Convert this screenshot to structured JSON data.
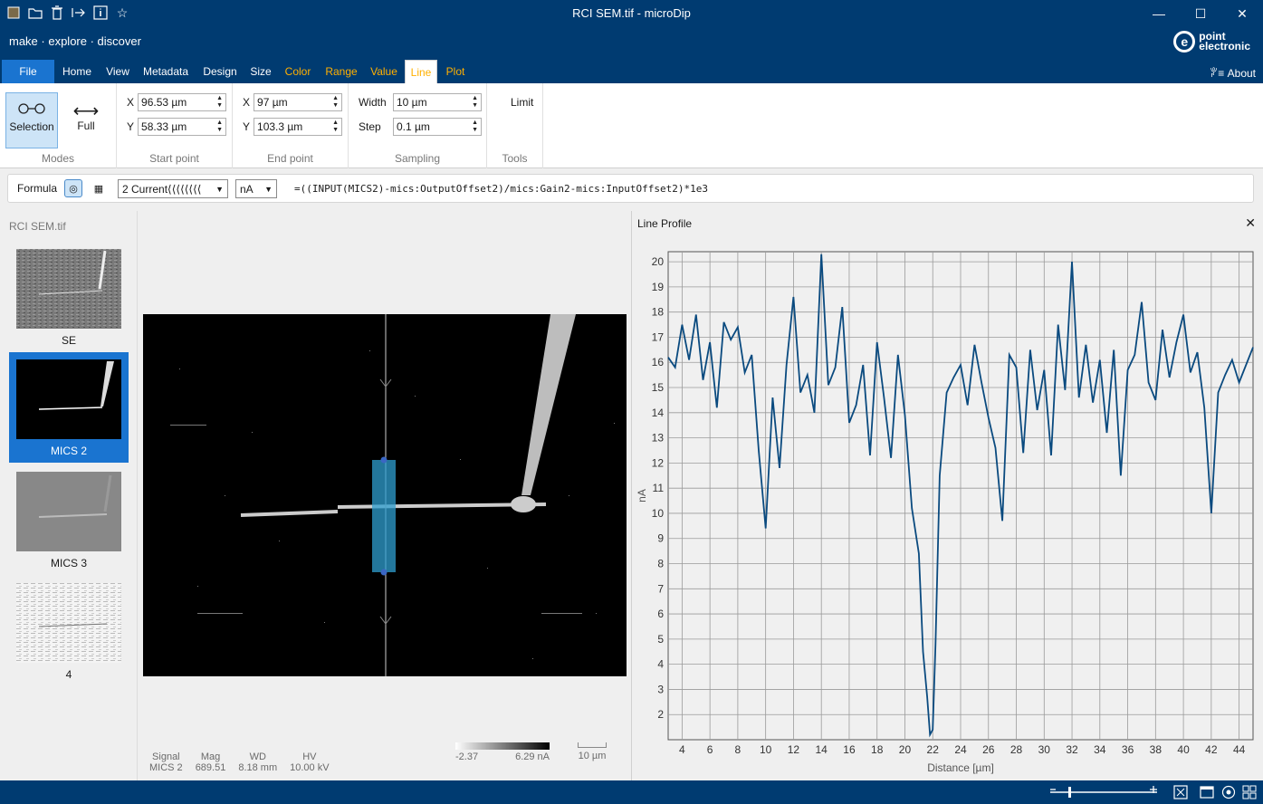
{
  "window": {
    "title": "RCI SEM.tif - microDip",
    "minimize": "—",
    "maximize": "☐",
    "close": "✕"
  },
  "brand": {
    "slogan": "make · explore · discover",
    "logo_line1": "point",
    "logo_line2": "electronic",
    "logo_mark": "e"
  },
  "menu": {
    "file": "File",
    "items": [
      "Home",
      "View",
      "Metadata",
      "Design",
      "Size",
      "Color",
      "Range",
      "Value",
      "Line",
      "Plot"
    ],
    "about": "About"
  },
  "ribbon": {
    "modes": {
      "label": "Modes",
      "selection": "Selection",
      "full": "Full"
    },
    "start": {
      "label": "Start point",
      "x_label": "X",
      "x": "96.53 µm",
      "y_label": "Y",
      "y": "58.33 µm"
    },
    "end": {
      "label": "End point",
      "x_label": "X",
      "x": "97 µm",
      "y_label": "Y",
      "y": "103.3 µm"
    },
    "sampling": {
      "label": "Sampling",
      "width_label": "Width",
      "width": "10 µm",
      "step_label": "Step",
      "step": "0.1 µm"
    },
    "tools": {
      "label": "Tools",
      "limit": "Limit"
    }
  },
  "formula": {
    "label": "Formula",
    "signal": "2 Current⟨⟨⟨⟨⟨⟨⟨⟨",
    "unit": "nA",
    "expr": "=((INPUT(MICS2)-mics:OutputOffset2)/mics:Gain2-mics:InputOffset2)*1e3"
  },
  "sidebar": {
    "title": "RCI SEM.tif",
    "items": [
      {
        "label": "SE"
      },
      {
        "label": "MICS 2"
      },
      {
        "label": "MICS 3"
      },
      {
        "label": "4"
      }
    ]
  },
  "viewer": {
    "info": {
      "signal_label": "Signal",
      "signal": "MICS 2",
      "mag_label": "Mag",
      "mag": "689.51",
      "wd_label": "WD",
      "wd": "8.18 mm",
      "hv_label": "HV",
      "hv": "10.00 kV"
    },
    "colorbar": {
      "min": "-2.37",
      "max": "6.29 nA"
    },
    "scalebar": "10 µm"
  },
  "plot": {
    "pane_title": "Line Profile",
    "close": "✕"
  },
  "chart_data": {
    "type": "line",
    "xlabel": "Distance [µm]",
    "ylabel": "nA",
    "xlim": [
      3,
      45
    ],
    "ylim": [
      1,
      20.4
    ],
    "xticks": [
      4,
      6,
      8,
      10,
      12,
      14,
      16,
      18,
      20,
      22,
      24,
      26,
      28,
      30,
      32,
      34,
      36,
      38,
      40,
      42,
      44
    ],
    "yticks": [
      2,
      3,
      4,
      5,
      6,
      7,
      8,
      9,
      10,
      11,
      12,
      13,
      14,
      15,
      16,
      17,
      18,
      19,
      20
    ],
    "grid": true,
    "series": [
      {
        "color": "#0a4a7f",
        "x": [
          3,
          3.5,
          4,
          4.5,
          5,
          5.5,
          6,
          6.5,
          7,
          7.5,
          8,
          8.5,
          9,
          9.5,
          10,
          10.5,
          11,
          11.5,
          12,
          12.5,
          13,
          13.5,
          14,
          14.5,
          15,
          15.5,
          16,
          16.5,
          17,
          17.5,
          18,
          18.5,
          19,
          19.5,
          20,
          20.5,
          21,
          21.3,
          21.6,
          21.8,
          22,
          22.2,
          22.5,
          23,
          23.5,
          24,
          24.5,
          25,
          25.5,
          26,
          26.5,
          27,
          27.5,
          28,
          28.5,
          29,
          29.5,
          30,
          30.5,
          31,
          31.5,
          32,
          32.5,
          33,
          33.5,
          34,
          34.5,
          35,
          35.5,
          36,
          36.5,
          37,
          37.5,
          38,
          38.5,
          39,
          39.5,
          40,
          40.5,
          41,
          41.5,
          42,
          42.5,
          43,
          43.5,
          44,
          44.5,
          45
        ],
        "y": [
          16.2,
          15.8,
          17.5,
          16.1,
          17.9,
          15.3,
          16.8,
          14.2,
          17.6,
          16.9,
          17.4,
          15.6,
          16.3,
          12.5,
          9.4,
          14.6,
          11.8,
          15.9,
          18.6,
          14.8,
          15.5,
          14.0,
          20.3,
          15.1,
          15.8,
          18.2,
          13.6,
          14.3,
          15.9,
          12.3,
          16.8,
          14.6,
          12.2,
          16.3,
          13.9,
          10.2,
          8.4,
          4.5,
          2.7,
          1.2,
          1.4,
          4.8,
          11.5,
          14.8,
          15.4,
          15.9,
          14.3,
          16.7,
          15.2,
          13.8,
          12.6,
          9.7,
          16.3,
          15.8,
          12.4,
          16.5,
          14.1,
          15.7,
          12.3,
          17.5,
          14.9,
          20.0,
          14.6,
          16.7,
          14.4,
          16.1,
          13.2,
          16.5,
          11.5,
          15.7,
          16.3,
          18.4,
          15.2,
          14.5,
          17.3,
          15.4,
          16.8,
          17.9,
          15.6,
          16.4,
          14.2,
          10.0,
          14.8,
          15.5,
          16.1,
          15.2,
          15.9,
          16.6
        ]
      }
    ]
  }
}
